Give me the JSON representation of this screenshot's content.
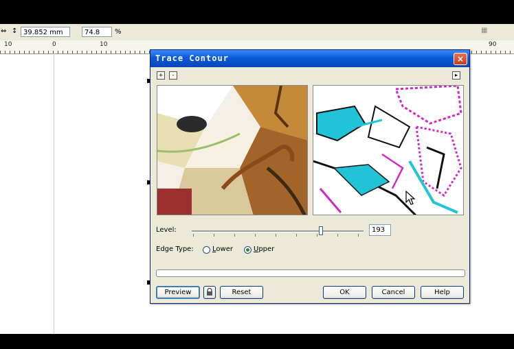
{
  "property_bar": {
    "height_value": "39.852 mm",
    "scale_value": "74.8",
    "scale_unit": "%"
  },
  "ruler": {
    "labels": [
      "10",
      "0",
      "10",
      "90"
    ]
  },
  "dialog": {
    "title": "Trace Contour",
    "close_glyph": "×",
    "level_label": "Level:",
    "level_value": "193",
    "level_fraction": 0.75,
    "edge_type_label": "Edge Type:",
    "edge_options": [
      "Lower",
      "Upper"
    ],
    "edge_selected": "Upper",
    "buttons": {
      "preview": "Preview",
      "reset": "Reset",
      "ok": "OK",
      "cancel": "Cancel",
      "help": "Help"
    }
  }
}
